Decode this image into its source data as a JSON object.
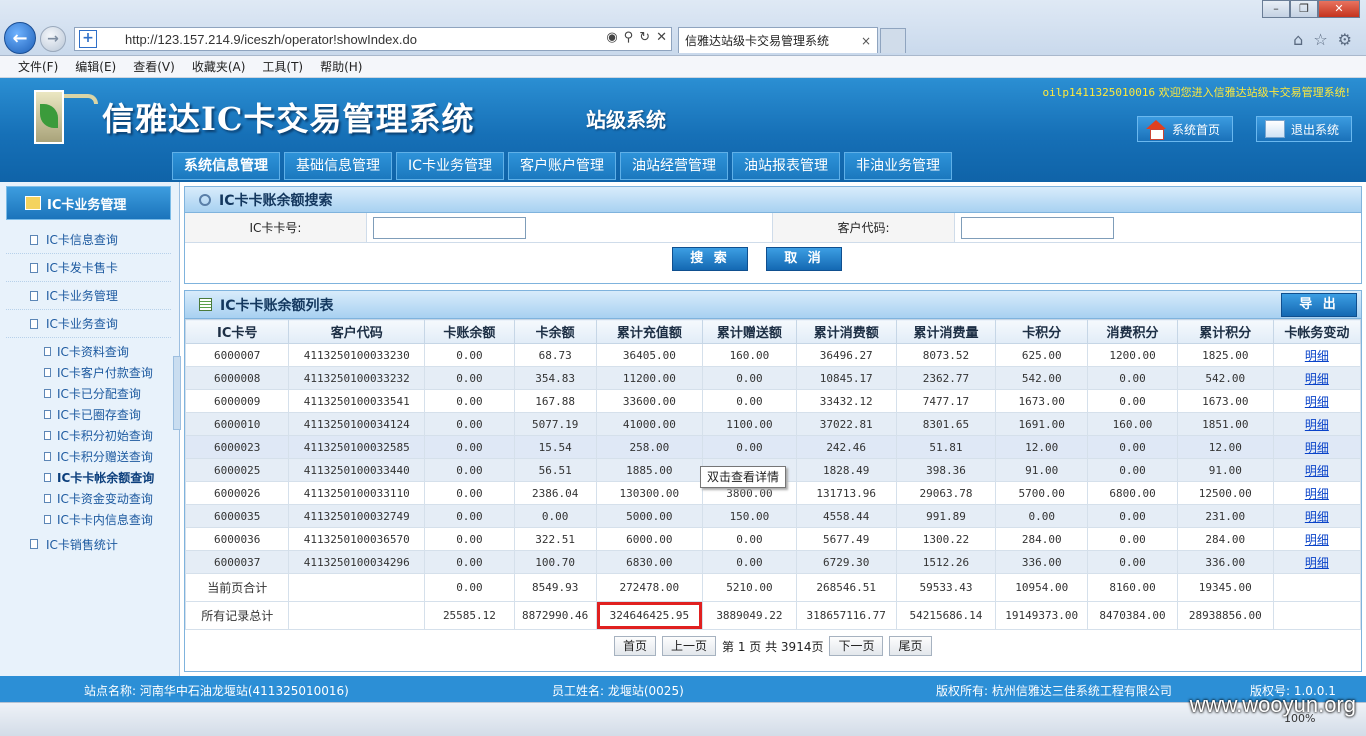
{
  "browser": {
    "url": "http://123.157.214.9/iceszh/operator!showIndex.do",
    "tab_title": "信雅达站级卡交易管理系统",
    "tab_close": "×",
    "menu": [
      "文件(F)",
      "编辑(E)",
      "查看(V)",
      "收藏夹(A)",
      "工具(T)",
      "帮助(H)"
    ],
    "zoom": "100%"
  },
  "app": {
    "title": "信雅达IC卡交易管理系统",
    "subtitle": "站级系统",
    "welcome_user": "oilp1411325010016",
    "welcome_text": " 欢迎您进入信雅达站级卡交易管理系统!",
    "home_label": "系统首页",
    "exit_label": "退出系统",
    "nav": [
      "系统信息管理",
      "基础信息管理",
      "IC卡业务管理",
      "客户账户管理",
      "油站经营管理",
      "油站报表管理",
      "非油业务管理"
    ]
  },
  "sidebar": {
    "title": "IC卡业务管理",
    "top_items": [
      "IC卡信息查询",
      "IC卡发卡售卡",
      "IC卡业务管理",
      "IC卡业务查询"
    ],
    "sub_items": [
      "IC卡资料查询",
      "IC卡客户付款查询",
      "IC卡已分配查询",
      "IC卡已圈存查询",
      "IC卡积分初始查询",
      "IC卡积分赠送查询",
      "IC卡卡帐余额查询",
      "IC卡资金变动查询",
      "IC卡卡内信息查询"
    ],
    "bottom_item": "IC卡销售统计"
  },
  "search": {
    "title": "IC卡卡账余额搜索",
    "card_label": "IC卡卡号:",
    "customer_label": "客户代码:",
    "card_value": "",
    "customer_value": "",
    "search_btn": "搜 索",
    "cancel_btn": "取 消"
  },
  "list": {
    "title": "IC卡卡账余额列表",
    "export_btn": "导 出",
    "columns": [
      "IC卡号",
      "客户代码",
      "卡账余额",
      "卡余额",
      "累计充值额",
      "累计赠送额",
      "累计消费额",
      "累计消费量",
      "卡积分",
      "消费积分",
      "累计积分",
      "卡帐务变动"
    ],
    "rows": [
      [
        "6000007",
        "4113250100033230",
        "0.00",
        "68.73",
        "36405.00",
        "160.00",
        "36496.27",
        "8073.52",
        "625.00",
        "1200.00",
        "1825.00",
        "明细"
      ],
      [
        "6000008",
        "4113250100033232",
        "0.00",
        "354.83",
        "11200.00",
        "0.00",
        "10845.17",
        "2362.77",
        "542.00",
        "0.00",
        "542.00",
        "明细"
      ],
      [
        "6000009",
        "4113250100033541",
        "0.00",
        "167.88",
        "33600.00",
        "0.00",
        "33432.12",
        "7477.17",
        "1673.00",
        "0.00",
        "1673.00",
        "明细"
      ],
      [
        "6000010",
        "4113250100034124",
        "0.00",
        "5077.19",
        "41000.00",
        "1100.00",
        "37022.81",
        "8301.65",
        "1691.00",
        "160.00",
        "1851.00",
        "明细"
      ],
      [
        "6000023",
        "4113250100032585",
        "0.00",
        "15.54",
        "258.00",
        "0.00",
        "242.46",
        "51.81",
        "12.00",
        "0.00",
        "12.00",
        "明细"
      ],
      [
        "6000025",
        "4113250100033440",
        "0.00",
        "56.51",
        "1885.00",
        "",
        "1828.49",
        "398.36",
        "91.00",
        "0.00",
        "91.00",
        "明细"
      ],
      [
        "6000026",
        "4113250100033110",
        "0.00",
        "2386.04",
        "130300.00",
        "3800.00",
        "131713.96",
        "29063.78",
        "5700.00",
        "6800.00",
        "12500.00",
        "明细"
      ],
      [
        "6000035",
        "4113250100032749",
        "0.00",
        "0.00",
        "5000.00",
        "150.00",
        "4558.44",
        "991.89",
        "0.00",
        "0.00",
        "231.00",
        "明细"
      ],
      [
        "6000036",
        "4113250100036570",
        "0.00",
        "322.51",
        "6000.00",
        "0.00",
        "5677.49",
        "1300.22",
        "284.00",
        "0.00",
        "284.00",
        "明细"
      ],
      [
        "6000037",
        "4113250100034296",
        "0.00",
        "100.70",
        "6830.00",
        "0.00",
        "6729.30",
        "1512.26",
        "336.00",
        "0.00",
        "336.00",
        "明细"
      ]
    ],
    "page_total": [
      "当前页合计",
      "",
      "0.00",
      "8549.93",
      "272478.00",
      "5210.00",
      "268546.51",
      "59533.43",
      "10954.00",
      "8160.00",
      "19345.00",
      ""
    ],
    "grand_total": [
      "所有记录总计",
      "",
      "25585.12",
      "8872990.46",
      "324646425.95",
      "3889049.22",
      "318657116.77",
      "54215686.14",
      "19149373.00",
      "8470384.00",
      "28938856.00",
      ""
    ],
    "tooltip": "双击查看详情"
  },
  "pager": {
    "first": "首页",
    "prev": "上一页",
    "info": "第 1 页 共 3914页",
    "next": "下一页",
    "last": "尾页"
  },
  "footer": {
    "station": "站点名称: 河南华中石油龙堰站(411325010016)",
    "staff": "员工姓名: 龙堰站(0025)",
    "copyright": "版权所有: 杭州信雅达三佳系统工程有限公司",
    "version": "版权号: 1.0.0.1"
  },
  "watermark": "www.wooyun.org",
  "colors": {
    "header_blue": "#1670b7",
    "highlight_red": "#e02020",
    "link_blue": "#0a43c9"
  }
}
